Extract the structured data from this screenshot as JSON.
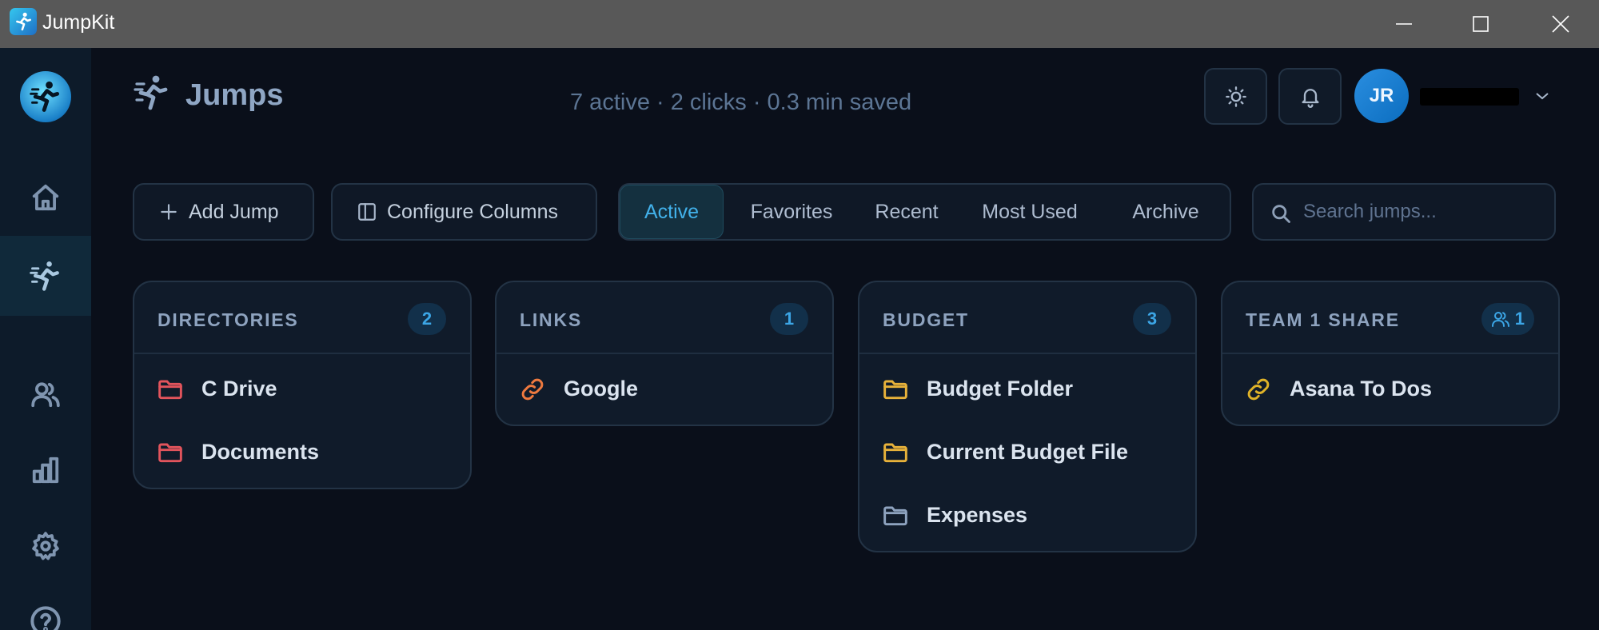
{
  "window": {
    "title": "JumpKit",
    "controls": [
      "minimize",
      "maximize",
      "close"
    ]
  },
  "sidebar": {
    "logo_icon": "runner-logo-icon",
    "items": [
      {
        "icon": "home-icon",
        "active": false
      },
      {
        "icon": "runner-icon",
        "active": true
      },
      {
        "icon": "users-icon",
        "active": false
      },
      {
        "icon": "bar-chart-icon",
        "active": false
      },
      {
        "icon": "gear-icon",
        "active": false
      },
      {
        "icon": "help-circle-icon",
        "active": false
      }
    ]
  },
  "header": {
    "title": "Jumps",
    "stats": "7 active · 2 clicks · 0.3 min saved",
    "theme_icon": "sun-icon",
    "notification_icon": "bell-icon",
    "user": {
      "initials": "JR",
      "name": "",
      "name_redacted": true
    }
  },
  "toolbar": {
    "add_label": "Add Jump",
    "configure_label": "Configure Columns",
    "tabs": [
      "Active",
      "Favorites",
      "Recent",
      "Most Used",
      "Archive"
    ],
    "active_tab": "Active",
    "search_placeholder": "Search jumps..."
  },
  "colors": {
    "accent": "#42b1ea",
    "folder_red": "#e2545c",
    "folder_yellow": "#e8b23a",
    "folder_gray": "#8ea3bf",
    "link_orange": "#ef7a3f",
    "link_yellow": "#e0b328"
  },
  "columns": [
    {
      "title": "DIRECTORIES",
      "count": "2",
      "shared": false,
      "items": [
        {
          "label": "C Drive",
          "icon": "folder-icon",
          "color": "#e2545c"
        },
        {
          "label": "Documents",
          "icon": "folder-icon",
          "color": "#e2545c"
        }
      ]
    },
    {
      "title": "LINKS",
      "count": "1",
      "shared": false,
      "items": [
        {
          "label": "Google",
          "icon": "link-icon",
          "color": "#ef7a3f"
        }
      ]
    },
    {
      "title": "BUDGET",
      "count": "3",
      "shared": false,
      "items": [
        {
          "label": "Budget Folder",
          "icon": "folder-icon",
          "color": "#e8b23a"
        },
        {
          "label": "Current Budget File",
          "icon": "folder-icon",
          "color": "#e8b23a"
        },
        {
          "label": "Expenses",
          "icon": "folder-icon",
          "color": "#8ea3bf"
        }
      ]
    },
    {
      "title": "TEAM 1 SHARE",
      "count": "1",
      "shared": true,
      "items": [
        {
          "label": "Asana To Dos",
          "icon": "link-icon",
          "color": "#e0b328"
        }
      ]
    }
  ]
}
